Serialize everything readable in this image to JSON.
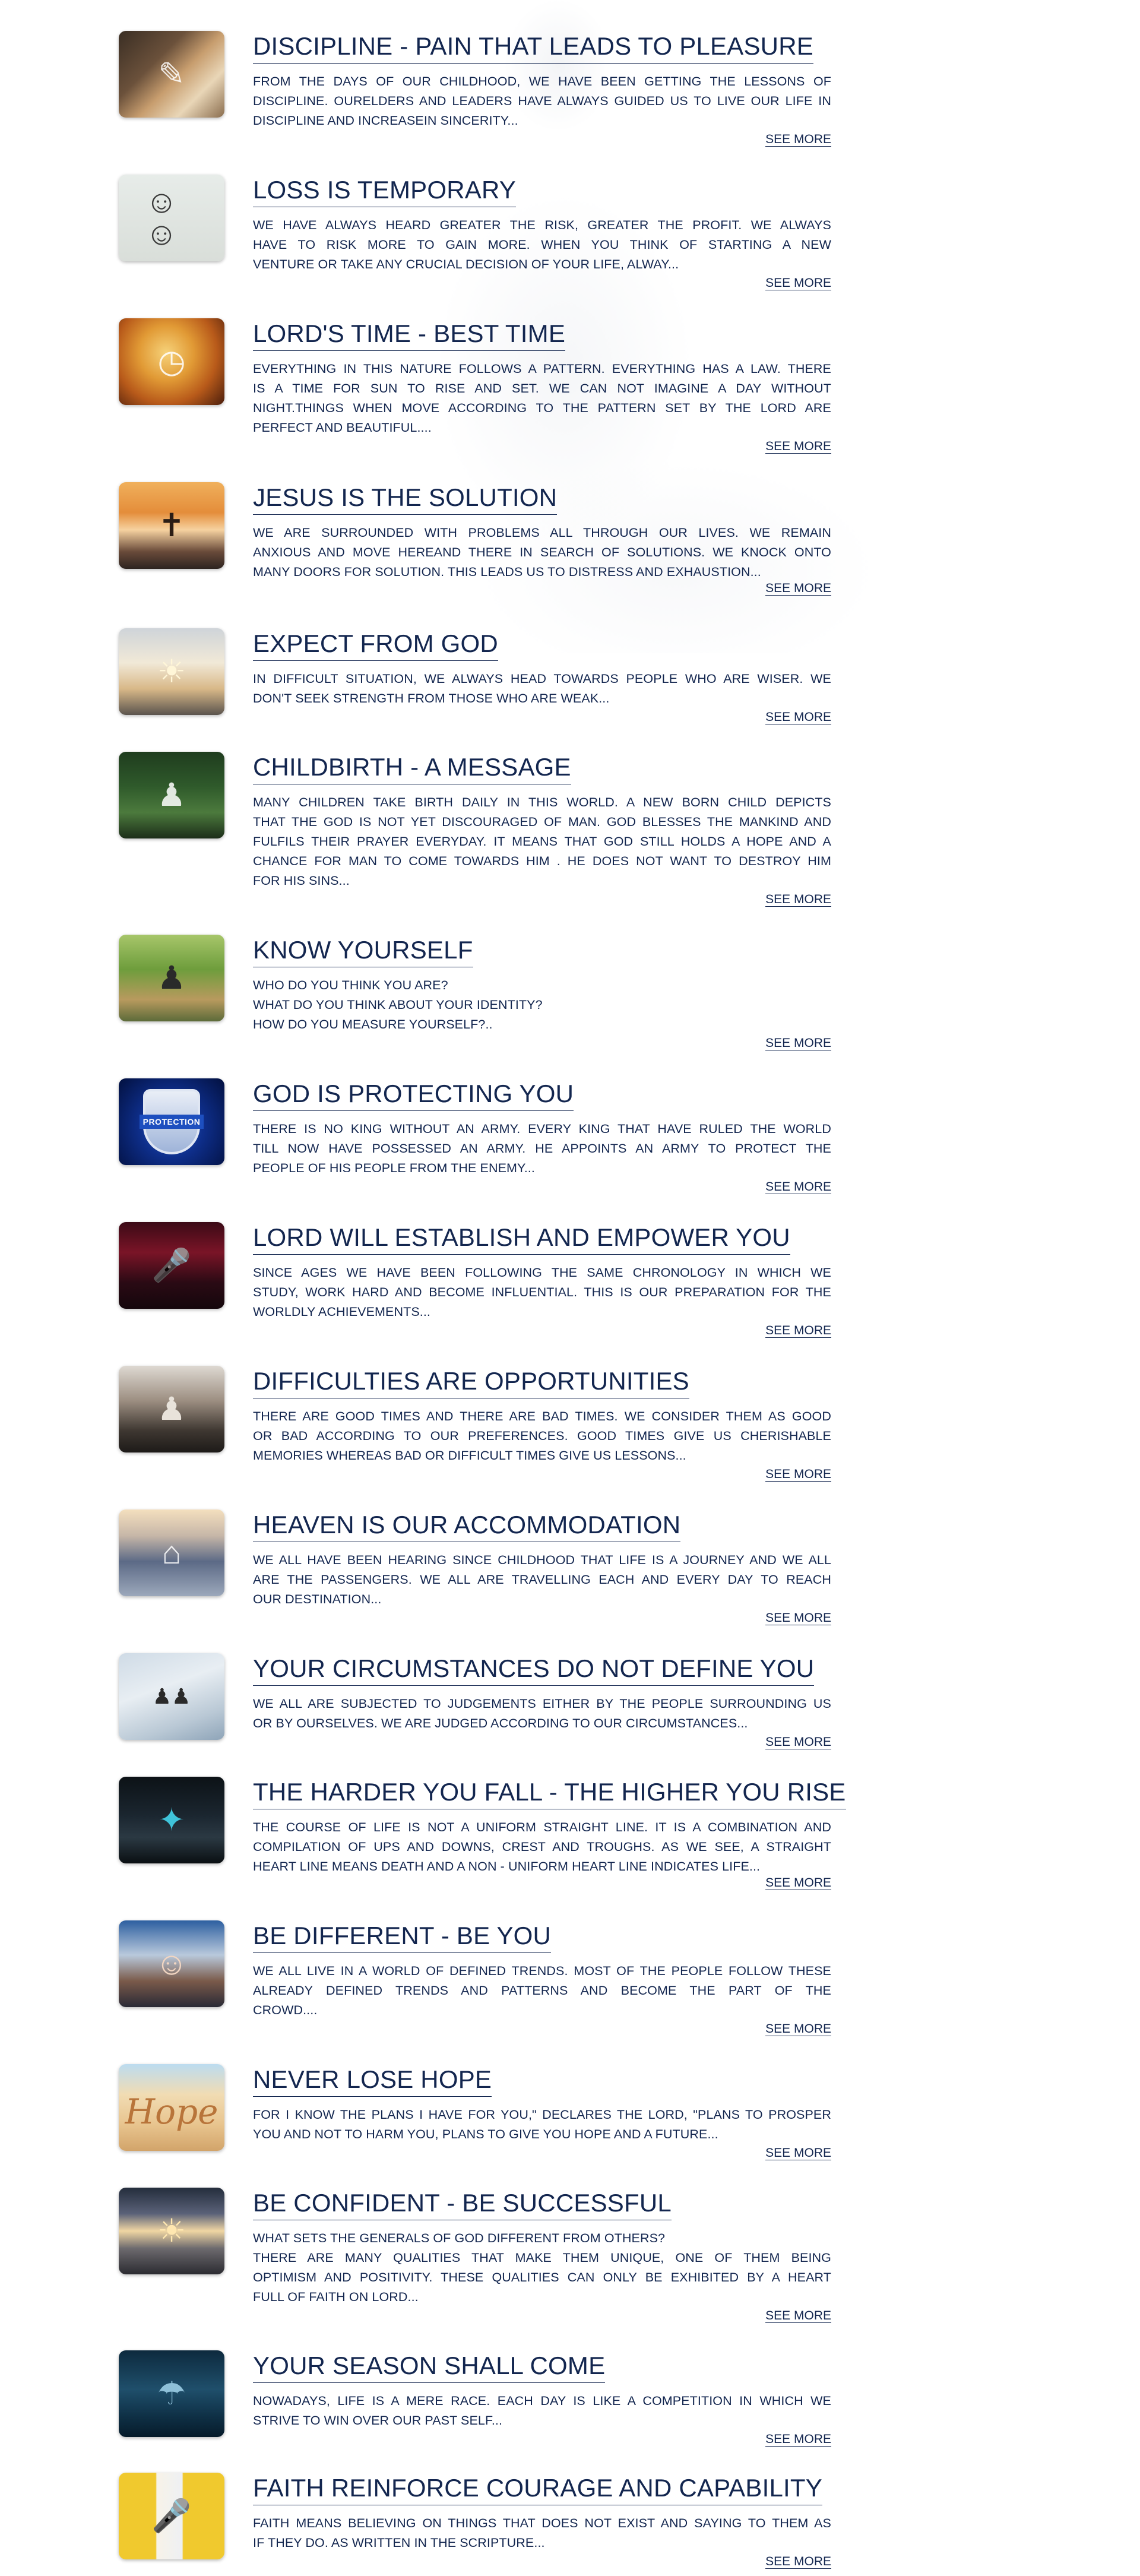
{
  "articles": [
    {
      "title": "DISCIPLINE - PAIN THAT LEADS TO PLEASURE",
      "image_icon": "book-hand-icon",
      "lines": [
        "FROM THE DAYS OF OUR CHILDHOOD, WE HAVE BEEN GETTING THE LESSONS OF",
        "DISCIPLINE. OURELDERS AND LEADERS HAVE ALWAYS GUIDED US TO LIVE OUR LIFE IN",
        "DISCIPLINE AND INCREASEIN SINCERITY..."
      ],
      "see_more": "SEE MORE"
    },
    {
      "title": "LOSS IS TEMPORARY",
      "image_icon": "family-portrait-icon",
      "lines": [
        "WE HAVE ALWAYS HEARD GREATER THE RISK, GREATER THE PROFIT. WE ALWAYS",
        "HAVE TO RISK MORE TO GAIN MORE. WHEN YOU THINK OF STARTING A NEW",
        "VENTURE OR TAKE ANY CRUCIAL DECISION OF YOUR LIFE, ALWAY..."
      ],
      "see_more": "SEE MORE"
    },
    {
      "title": "LORD'S TIME - BEST TIME",
      "image_icon": "clock-icon",
      "lines": [
        "EVERYTHING IN THIS NATURE FOLLOWS A PATTERN. EVERYTHING HAS A LAW. THERE",
        "IS A TIME FOR SUN TO RISE AND SET. WE CAN NOT IMAGINE A DAY WITHOUT",
        "NIGHT.THINGS WHEN MOVE ACCORDING TO THE PATTERN SET BY THE LORD ARE",
        "PERFECT AND BEAUTIFUL...."
      ],
      "see_more": "SEE MORE"
    },
    {
      "title": "JESUS IS THE SOLUTION",
      "image_icon": "sunset-figure-icon",
      "lines": [
        "WE ARE SURROUNDED WITH PROBLEMS ALL THROUGH OUR LIVES. WE REMAIN",
        "ANXIOUS AND MOVE HEREAND THERE IN SEARCH OF SOLUTIONS. WE KNOCK ONTO",
        "MANY DOORS FOR SOLUTION. THIS LEADS US TO DISTRESS AND EXHAUSTION..."
      ],
      "see_more": "SEE MORE"
    },
    {
      "title": "EXPECT FROM GOD",
      "image_icon": "sunrise-icon",
      "lines": [
        "IN DIFFICULT SITUATION, WE ALWAYS HEAD TOWARDS PEOPLE WHO ARE WISER. WE",
        "DON'T SEEK STRENGTH FROM THOSE WHO ARE WEAK..."
      ],
      "see_more": "SEE MORE"
    },
    {
      "title": "CHILDBIRTH - A MESSAGE",
      "image_icon": "child-swing-icon",
      "lines": [
        "MANY CHILDREN TAKE BIRTH DAILY IN THIS WORLD. A NEW BORN CHILD DEPICTS",
        "THAT THE GOD IS NOT YET DISCOURAGED OF MAN. GOD BLESSES THE MANKIND AND",
        "FULFILS THEIR PRAYER EVERYDAY. IT MEANS THAT GOD STILL HOLDS A HOPE AND A",
        "CHANCE FOR MAN TO COME TOWARDS HIM . HE DOES NOT WANT TO DESTROY HIM",
        "FOR HIS SINS..."
      ],
      "see_more": "SEE MORE"
    },
    {
      "title": "KNOW YOURSELF",
      "image_icon": "man-bench-icon",
      "lines": [
        "WHO DO YOU THINK YOU ARE?",
        "WHAT DO YOU THINK ABOUT YOUR IDENTITY?",
        "HOW DO YOU MEASURE YOURSELF?.."
      ],
      "see_more": "SEE MORE"
    },
    {
      "title": "GOD IS PROTECTING YOU",
      "image_icon": "protection-shield-icon",
      "image_text": "PROTECTION",
      "lines": [
        "THERE IS NO KING WITHOUT AN ARMY. EVERY KING THAT HAVE RULED THE WORLD",
        "TILL NOW HAVE POSSESSED AN ARMY. HE APPOINTS AN ARMY TO PROTECT THE",
        "PEOPLE OF HIS PEOPLE FROM THE ENEMY..."
      ],
      "see_more": "SEE MORE"
    },
    {
      "title": "LORD WILL ESTABLISH AND EMPOWER YOU",
      "image_icon": "speaker-stage-icon",
      "lines": [
        "SINCE AGES WE HAVE BEEN FOLLOWING THE SAME CHRONOLOGY IN WHICH WE",
        "STUDY, WORK HARD AND BECOME INFLUENTIAL. THIS IS OUR PREPARATION FOR THE",
        "WORLDLY ACHIEVEMENTS..."
      ],
      "see_more": "SEE MORE"
    },
    {
      "title": "DIFFICULTIES ARE OPPORTUNITIES",
      "image_icon": "man-portrait-icon",
      "lines": [
        "THERE ARE GOOD TIMES AND THERE ARE BAD TIMES. WE CONSIDER THEM AS GOOD",
        "OR BAD ACCORDING TO OUR PREFERENCES. GOOD TIMES GIVE US CHERISHABLE",
        "MEMORIES WHEREAS BAD OR DIFFICULT TIMES GIVE US LESSONS..."
      ],
      "see_more": "SEE MORE"
    },
    {
      "title": "HEAVEN IS OUR ACCOMMODATION",
      "image_icon": "house-clouds-icon",
      "lines": [
        "WE ALL HAVE BEEN HEARING SINCE CHILDHOOD THAT LIFE IS A JOURNEY AND WE ALL",
        "ARE THE PASSENGERS. WE ALL ARE TRAVELLING EACH AND EVERY DAY TO REACH",
        "OUR DESTINATION..."
      ],
      "see_more": "SEE MORE"
    },
    {
      "title": "YOUR CIRCUMSTANCES DO NOT DEFINE YOU",
      "image_icon": "hikers-snow-icon",
      "lines": [
        "WE ALL ARE SUBJECTED TO JUDGEMENTS EITHER BY THE PEOPLE SURROUNDING US",
        "OR BY OURSELVES. WE ARE JUDGED ACCORDING TO OUR CIRCUMSTANCES..."
      ],
      "see_more": "SEE MORE"
    },
    {
      "title": "THE HARDER YOU FALL - THE HIGHER YOU RISE",
      "image_icon": "climber-icon",
      "lines": [
        "THE COURSE OF LIFE IS NOT A UNIFORM STRAIGHT LINE. IT IS A COMBINATION AND",
        "COMPILATION OF UPS AND DOWNS, CREST AND TROUGHS. AS WE SEE, A STRAIGHT",
        "HEART LINE MEANS DEATH AND A NON - UNIFORM HEART LINE INDICATES LIFE..."
      ],
      "see_more": "SEE MORE"
    },
    {
      "title": "BE DIFFERENT - BE YOU",
      "image_icon": "man-selfie-icon",
      "lines": [
        "WE ALL LIVE IN A WORLD OF DEFINED TRENDS. MOST OF THE PEOPLE FOLLOW THESE",
        "ALREADY DEFINED TRENDS AND PATTERNS AND BECOME THE PART OF THE",
        "CROWD...."
      ],
      "see_more": "SEE MORE"
    },
    {
      "title": "NEVER LOSE HOPE",
      "image_icon": "hope-sand-icon",
      "image_text": "Hope",
      "lines": [
        "FOR I KNOW THE PLANS I HAVE FOR YOU,\" DECLARES THE LORD, \"PLANS TO PROSPER",
        "YOU AND NOT TO HARM YOU, PLANS TO GIVE YOU HOPE AND A FUTURE..."
      ],
      "see_more": "SEE MORE"
    },
    {
      "title": "BE CONFIDENT - BE SUCCESSFUL",
      "image_icon": "pier-sunset-icon",
      "lines": [
        "WHAT SETS THE GENERALS OF GOD DIFFERENT FROM OTHERS?",
        "THERE ARE MANY QUALITIES THAT MAKE THEM UNIQUE, ONE OF THEM BEING",
        "OPTIMISM AND POSITIVITY. THESE QUALITIES CAN ONLY BE EXHIBITED BY A HEART",
        "FULL OF FAITH ON LORD..."
      ],
      "see_more": "SEE MORE"
    },
    {
      "title": "YOUR SEASON SHALL COME",
      "image_icon": "rain-water-icon",
      "lines": [
        "NOWADAYS, LIFE IS A MERE RACE. EACH DAY IS LIKE A COMPETITION IN WHICH WE",
        "STRIVE TO WIN OVER OUR PAST SELF..."
      ],
      "see_more": "SEE MORE"
    },
    {
      "title": "FAITH REINFORCE COURAGE AND CAPABILITY",
      "image_icon": "speaker-microphone-icon",
      "lines": [
        "FAITH MEANS BELIEVING ON THINGS THAT DOES NOT EXIST AND SAYING TO THEM AS",
        "IF THEY DO. AS WRITTEN IN THE SCRIPTURE..."
      ],
      "see_more": "SEE MORE"
    }
  ]
}
